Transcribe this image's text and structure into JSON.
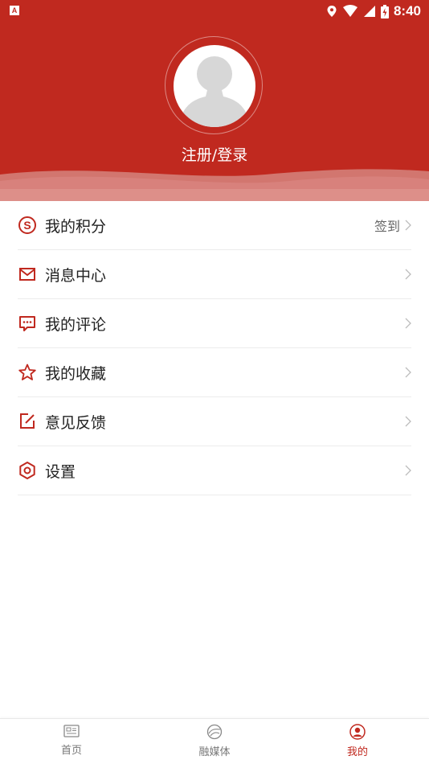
{
  "status_bar": {
    "time": "8:40",
    "colors": {
      "icons": "#ffffff"
    }
  },
  "profile": {
    "login_text": "注册/登录",
    "avatar_icon": "default-avatar"
  },
  "menu": [
    {
      "label": "我的积分",
      "icon": "points-icon",
      "extra": "签到"
    },
    {
      "label": "消息中心",
      "icon": "mail-icon",
      "extra": ""
    },
    {
      "label": "我的评论",
      "icon": "comment-icon",
      "extra": ""
    },
    {
      "label": "我的收藏",
      "icon": "star-icon",
      "extra": ""
    },
    {
      "label": "意见反馈",
      "icon": "edit-icon",
      "extra": ""
    },
    {
      "label": "设置",
      "icon": "settings-icon",
      "extra": ""
    }
  ],
  "tabbar": {
    "tabs": [
      {
        "label": "首页",
        "icon": "news-icon",
        "active": false
      },
      {
        "label": "融媒体",
        "icon": "media-icon",
        "active": false
      },
      {
        "label": "我的",
        "icon": "user-icon",
        "active": true
      }
    ]
  },
  "colors": {
    "brand": "#c0291f",
    "text": "#222222",
    "divider": "#ececec"
  }
}
